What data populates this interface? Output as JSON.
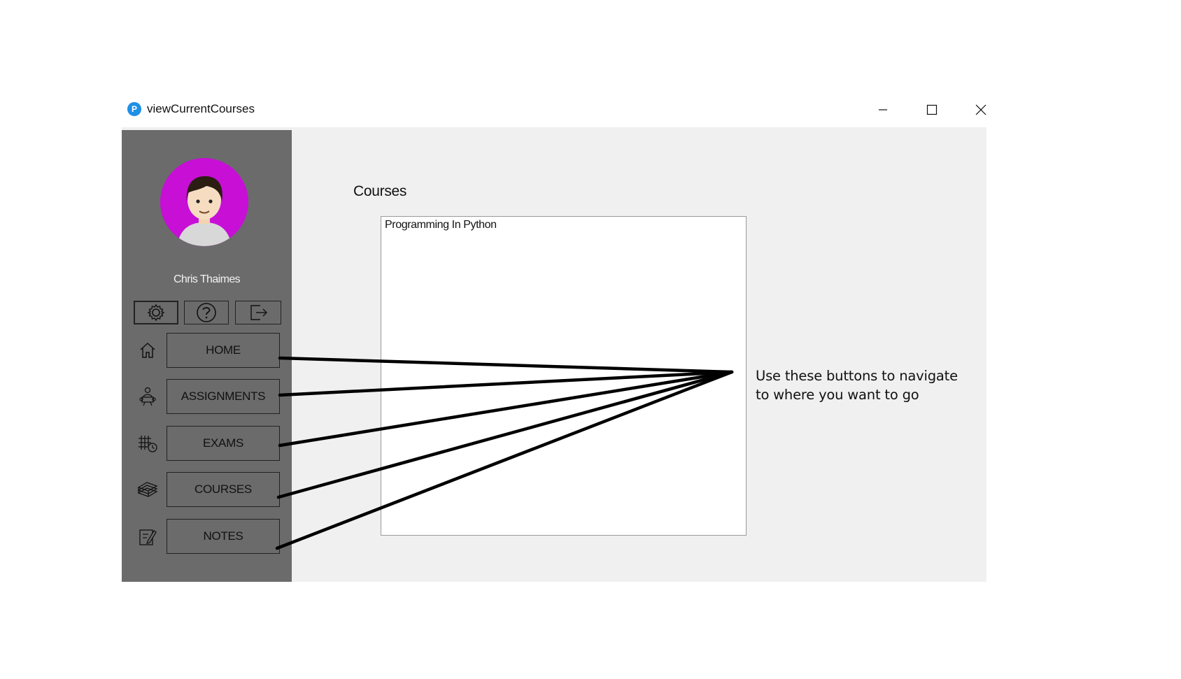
{
  "window": {
    "title": "viewCurrentCourses",
    "app_icon": "app-icon"
  },
  "sidebar": {
    "user_name": "Chris Thaimes",
    "icon_buttons": [
      {
        "icon": "gear-icon"
      },
      {
        "icon": "help-icon"
      },
      {
        "icon": "logout-icon"
      }
    ],
    "nav": [
      {
        "label": "HOME",
        "icon": "home-icon"
      },
      {
        "label": "ASSIGNMENTS",
        "icon": "assignments-icon"
      },
      {
        "label": "EXAMS",
        "icon": "exams-icon"
      },
      {
        "label": "COURSES",
        "icon": "courses-icon"
      },
      {
        "label": "NOTES",
        "icon": "notes-icon"
      }
    ]
  },
  "main": {
    "courses_label": "Courses",
    "courses": [
      "Programming In Python"
    ]
  },
  "annotation": {
    "line1": "Use these buttons to navigate",
    "line2": "to where you want to go"
  },
  "colors": {
    "sidebar": "#6b6b6b",
    "client": "#f0f0f0",
    "avatar_bg": "#c70fd6"
  }
}
